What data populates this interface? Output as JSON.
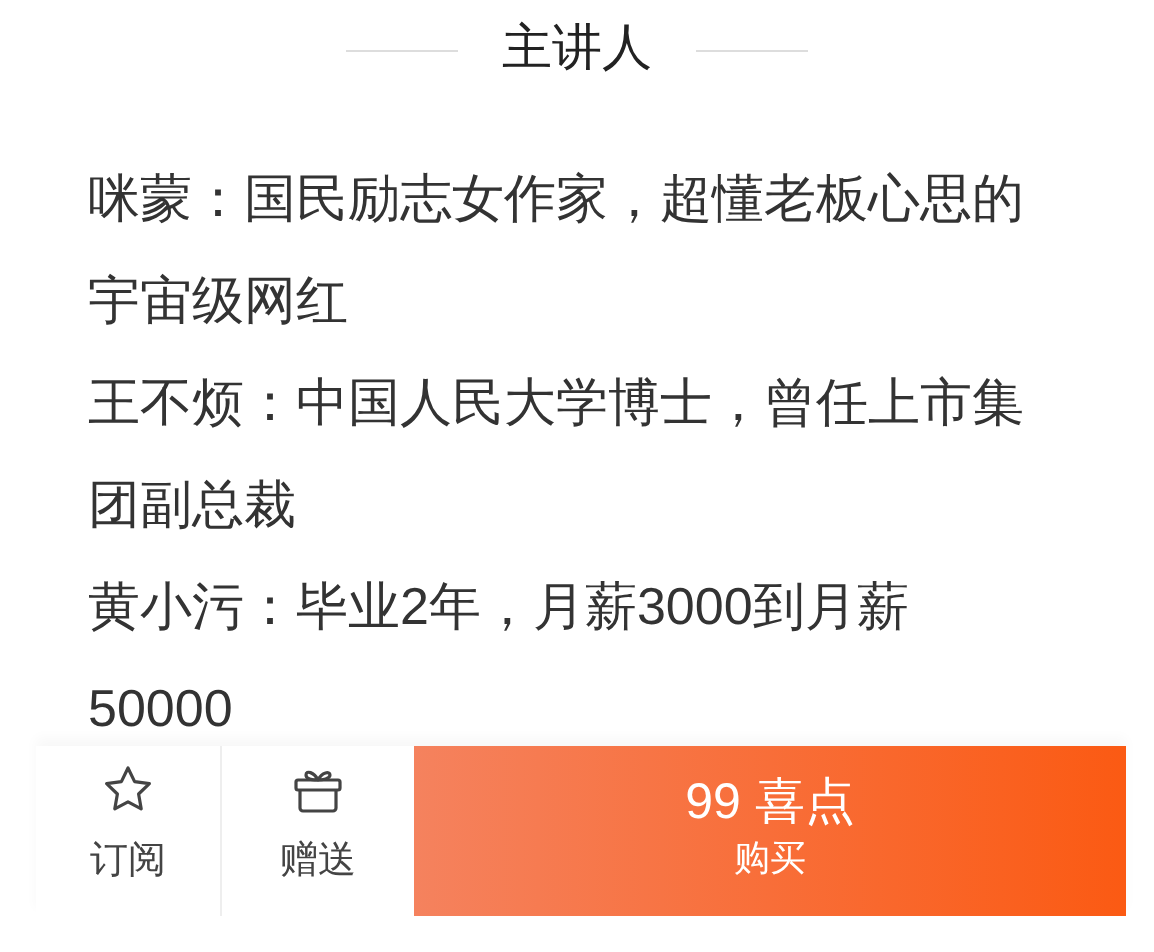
{
  "section_title": "主讲人",
  "speakers": [
    "咪蒙：国民励志女作家，超懂老板心思的宇宙级网红",
    "王不烦：中国人民大学博士，曾任上市集团副总裁",
    "黄小污：毕业2年，月薪3000到月薪50000"
  ],
  "bottom_bar": {
    "actions": [
      {
        "kind": "star",
        "label": "订阅"
      },
      {
        "kind": "gift",
        "label": "赠送"
      }
    ],
    "buy_button": {
      "price": "99 喜点",
      "label": "购买"
    }
  }
}
